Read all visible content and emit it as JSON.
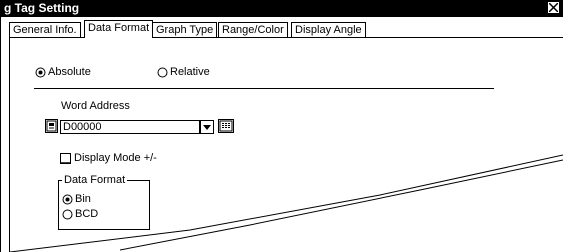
{
  "window": {
    "title": "g Tag Setting",
    "close_label": "X"
  },
  "tabs": [
    {
      "label": "General Info.",
      "active": false
    },
    {
      "label": "Data Format",
      "active": true
    },
    {
      "label": "Graph Type",
      "active": false
    },
    {
      "label": "Range/Color",
      "active": false
    },
    {
      "label": "Display Angle",
      "active": false
    }
  ],
  "address_mode": {
    "options": [
      "Absolute",
      "Relative"
    ],
    "selected": "Absolute"
  },
  "word_address": {
    "label": "Word Address",
    "value": "D00000",
    "icons": [
      "device-icon",
      "chevron-down-icon",
      "keypad-icon"
    ]
  },
  "display_mode": {
    "label": "Display Mode +/-",
    "checked": false
  },
  "data_format": {
    "group_title": "Data Format",
    "options": [
      "Bin",
      "BCD"
    ],
    "selected": "Bin"
  }
}
